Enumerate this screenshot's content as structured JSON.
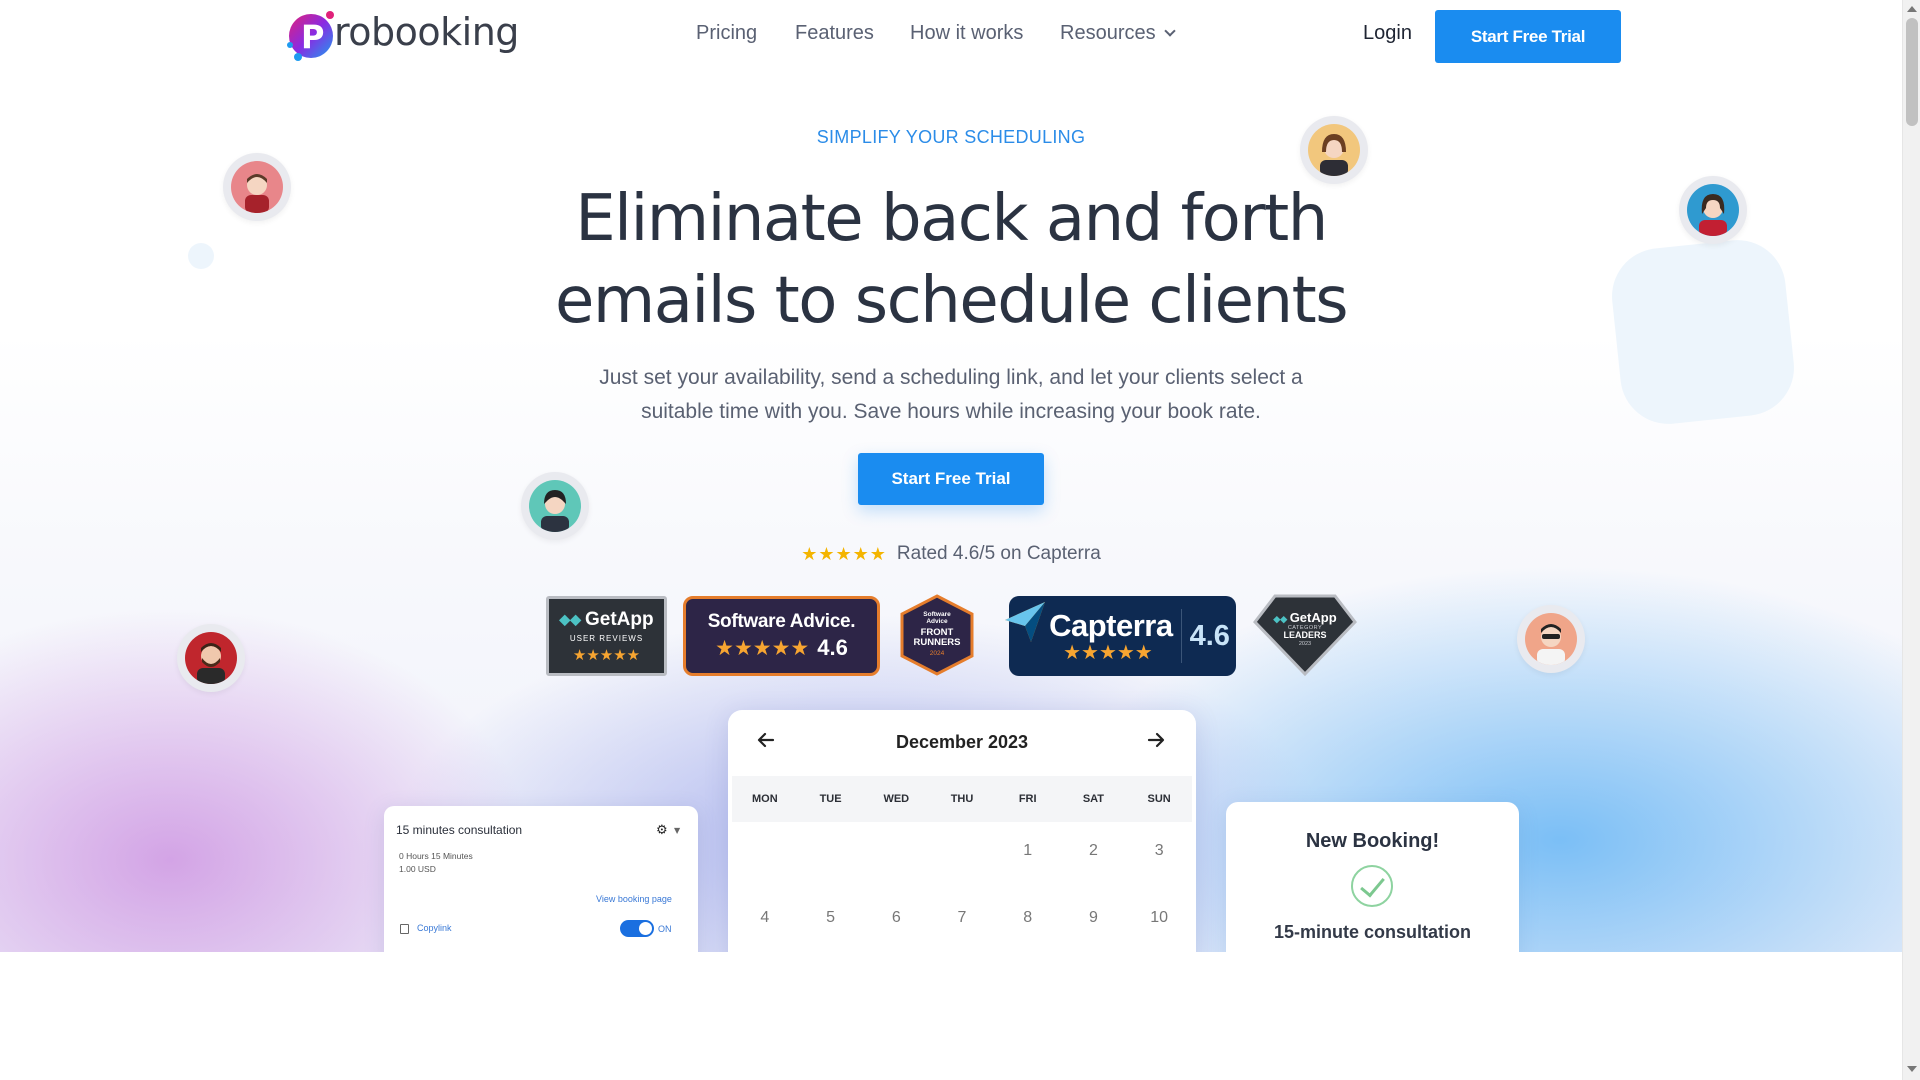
{
  "brand": {
    "logo_text": "robooking",
    "logo_letter": "P"
  },
  "nav": {
    "links": [
      "Pricing",
      "Features",
      "How it works",
      "Resources"
    ],
    "login": "Login",
    "cta": "Start Free Trial"
  },
  "hero": {
    "eyebrow": "SIMPLIFY YOUR SCHEDULING",
    "headline_line1": "Eliminate back and forth",
    "headline_line2": "emails to schedule clients",
    "subtext_line1": "Just set your availability, send a scheduling link, and let your clients select a",
    "subtext_line2": "suitable time with you. Save hours while increasing your book rate.",
    "cta": "Start Free Trial",
    "rating_stars": "★★★★★",
    "rating_text": "Rated 4.6/5 on Capterra"
  },
  "badges": {
    "getapp": {
      "brand": "GetApp",
      "caption": "USER REVIEWS",
      "stars": "★★★★★"
    },
    "software_advice": {
      "brand": "Software Advice.",
      "stars": "★★★★★",
      "score": "4.6"
    },
    "front_runners": {
      "line1": "Software",
      "line2": "Advice",
      "line3": "FRONT",
      "line4": "RUNNERS",
      "year": "2024"
    },
    "capterra": {
      "brand": "Capterra",
      "stars": "★★★★★",
      "score": "4.6"
    },
    "getapp_leaders": {
      "brand": "GetApp",
      "line1": "CATEGORY",
      "line2": "LEADERS",
      "year": "2023"
    }
  },
  "consult_card": {
    "title": "15 minutes consultation",
    "duration": "0 Hours 15 Minutes",
    "price": "1.00 USD",
    "view_link": "View booking page",
    "copy_link": "Copylink",
    "toggle_label": "ON"
  },
  "calendar": {
    "month": "December 2023",
    "days_of_week": [
      "MON",
      "TUE",
      "WED",
      "THU",
      "FRI",
      "SAT",
      "SUN"
    ],
    "days": [
      "",
      "",
      "",
      "",
      "1",
      "2",
      "3",
      "4",
      "5",
      "6",
      "7",
      "8",
      "9",
      "10"
    ]
  },
  "booking_card": {
    "title": "New Booking!",
    "subtitle": "15-minute consultation"
  },
  "colors": {
    "accent": "#1a8cf0",
    "heading": "#2b3342",
    "eyebrow": "#2b8ce8",
    "star": "#f4b400"
  }
}
